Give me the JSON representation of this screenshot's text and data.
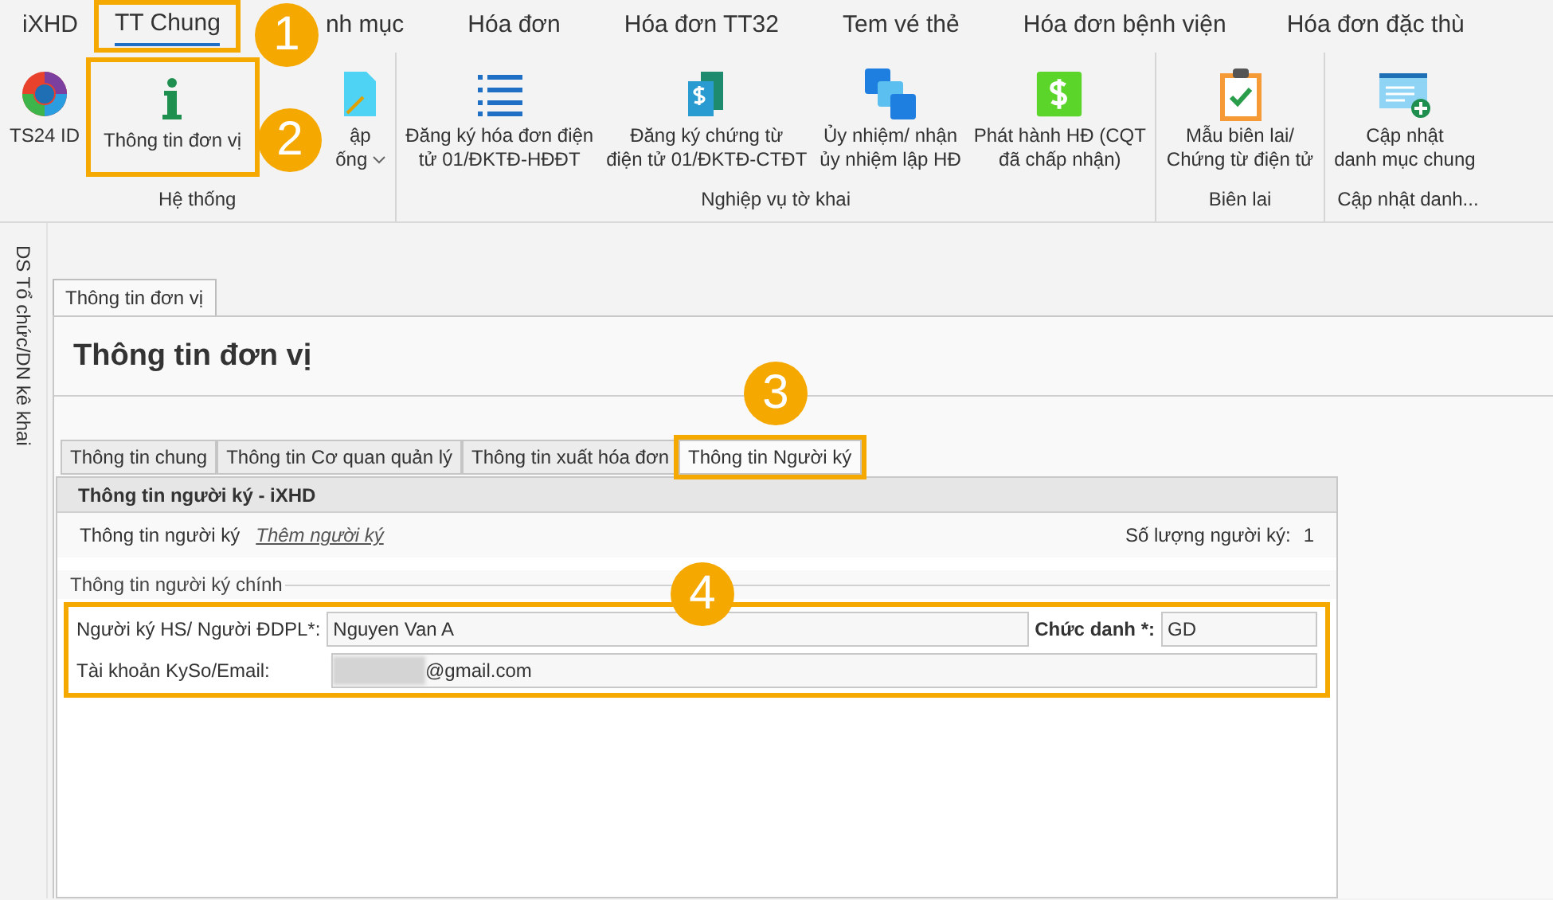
{
  "ribbon_tabs": [
    {
      "label": "iXHD",
      "selected": false
    },
    {
      "label": "TT Chung",
      "selected": true,
      "callout": "1"
    },
    {
      "label": "nh mục",
      "selected": false
    },
    {
      "label": "Hóa đơn",
      "selected": false
    },
    {
      "label": "Hóa đơn TT32",
      "selected": false
    },
    {
      "label": "Tem vé thẻ",
      "selected": false
    },
    {
      "label": "Hóa đơn bệnh viện",
      "selected": false
    },
    {
      "label": "Hóa đơn đặc thù",
      "selected": false
    }
  ],
  "ribbon_groups": [
    {
      "label": "Hệ thống",
      "buttons": [
        {
          "kind": "ring",
          "lines": [
            "TS24 ID"
          ]
        },
        {
          "kind": "info",
          "lines": [
            "Thông tin đơn vị"
          ],
          "callout": "2"
        },
        {
          "kind": "doc",
          "lines": [
            "ập",
            "ống"
          ],
          "dropdown": true
        }
      ]
    },
    {
      "label": "Nghiệp vụ tờ khai",
      "buttons": [
        {
          "kind": "list",
          "lines": [
            "Đăng ký hóa đơn điện",
            "tử 01/ĐKTĐ-HĐĐT"
          ]
        },
        {
          "kind": "money-doc",
          "lines": [
            "Đăng ký chứng từ",
            "điện tử 01/ĐKTĐ-CTĐT"
          ]
        },
        {
          "kind": "squares",
          "lines": [
            "Ủy nhiệm/ nhận",
            "ủy nhiệm lập HĐ"
          ]
        },
        {
          "kind": "dollar",
          "lines": [
            "Phát hành HĐ (CQT",
            "đã chấp nhận)"
          ]
        }
      ]
    },
    {
      "label": "Biên lai",
      "buttons": [
        {
          "kind": "clipboard",
          "lines": [
            "Mẫu biên lai/",
            "Chứng từ điện tử"
          ]
        }
      ]
    },
    {
      "label": "Cập nhật danh...",
      "buttons": [
        {
          "kind": "card-plus",
          "lines": [
            "Cập nhật",
            "danh mục chung"
          ]
        }
      ]
    }
  ],
  "side_panel": {
    "title": "DS Tổ chức/DN kê khai"
  },
  "document_tab": {
    "label": "Thông tin đơn vị"
  },
  "page_title": "Thông tin đơn vị",
  "inner_tabs": [
    {
      "label": "Thông tin chung",
      "selected": false
    },
    {
      "label": "Thông tin Cơ quan quản lý",
      "selected": false
    },
    {
      "label": "Thông tin xuất hóa đơn",
      "selected": false
    },
    {
      "label": "Thông tin Người ký",
      "selected": true,
      "callout": "3"
    }
  ],
  "panel": {
    "header": "Thông tin người ký - iXHD",
    "row_label": "Thông tin người ký",
    "add_link": "Thêm người ký",
    "count_label": "Số lượng người ký:",
    "count": "1",
    "group_title": "Thông tin người ký chính",
    "callout": "4",
    "signer_label": "Người ký HS/ Người ĐDPL*:",
    "signer_value": "Nguyen Van A",
    "position_label": "Chức danh *:",
    "position_value": "GD",
    "account_label": "Tài khoản KySo/Email:",
    "account_value": "@gmail.com",
    "account_blurred": true
  }
}
